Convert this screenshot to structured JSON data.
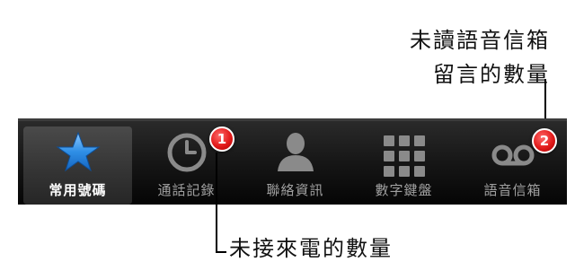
{
  "callouts": {
    "voicemail_line1": "未讀語音信箱",
    "voicemail_line2": "留言的數量",
    "missed_calls": "未接來電的數量"
  },
  "tabbar": {
    "tabs": [
      {
        "label": "常用號碼",
        "icon": "star-icon",
        "selected": true
      },
      {
        "label": "通話記錄",
        "icon": "clock-icon",
        "badge": "1"
      },
      {
        "label": "聯絡資訊",
        "icon": "person-icon"
      },
      {
        "label": "數字鍵盤",
        "icon": "keypad-icon"
      },
      {
        "label": "語音信箱",
        "icon": "voicemail-icon",
        "badge": "2"
      }
    ]
  },
  "colors": {
    "tabbar_background": "#111111",
    "selected_tab": "#3a3a3a",
    "star_blue": "#2f8fe6",
    "badge_red": "#e21b1b",
    "inactive_icon": "#8a8a8a"
  }
}
